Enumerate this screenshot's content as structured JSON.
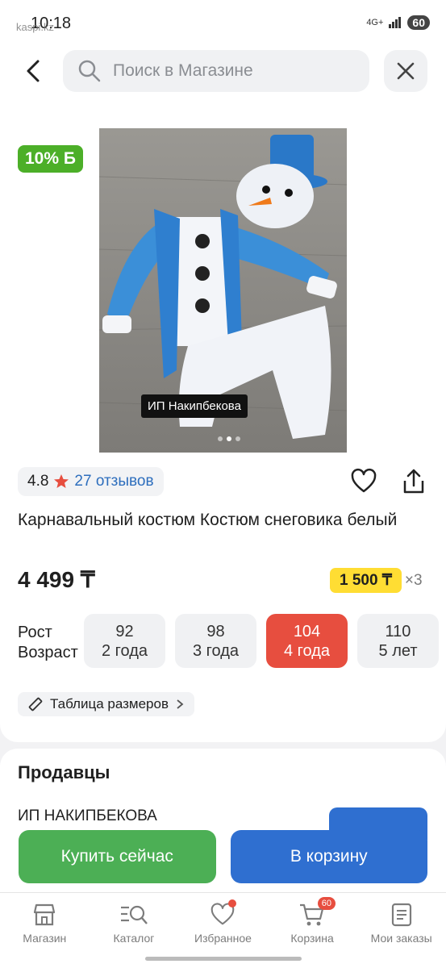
{
  "status": {
    "time": "10:18",
    "app": "kaspi.kz",
    "network": "4G+",
    "battery": "60"
  },
  "search": {
    "placeholder": "Поиск в Магазине"
  },
  "product": {
    "badge": "10% Б",
    "seller_tag": "ИП Накипбекова",
    "rating": "4.8",
    "reviews": "27 отзывов",
    "title": "Карнавальный костюм Костюм снеговика белый",
    "price": "4 499 ₸",
    "installment_amount": "1 500 ₸",
    "installment_times": "×3",
    "size_labels": {
      "height": "Рост",
      "age": "Возраст"
    },
    "sizes": [
      {
        "height": "92",
        "age": "2 года",
        "selected": false
      },
      {
        "height": "98",
        "age": "3 года",
        "selected": false
      },
      {
        "height": "104",
        "age": "4 года",
        "selected": true
      },
      {
        "height": "110",
        "age": "5 лет",
        "selected": false
      }
    ],
    "size_table": "Таблица размеров"
  },
  "sellers": {
    "heading": "Продавцы",
    "first_seller": "ИП НАКИПБЕКОВА"
  },
  "actions": {
    "buy_now": "Купить сейчас",
    "add_to_cart": "В корзину"
  },
  "nav": {
    "items": [
      {
        "label": "Магазин",
        "icon": "store-icon"
      },
      {
        "label": "Каталог",
        "icon": "catalog-search-icon"
      },
      {
        "label": "Избранное",
        "icon": "heart-icon"
      },
      {
        "label": "Корзина",
        "icon": "cart-icon",
        "count": "60"
      },
      {
        "label": "Мои заказы",
        "icon": "orders-icon"
      }
    ]
  },
  "colors": {
    "accent_blue": "#2f6fd0",
    "buy_green": "#4caf55",
    "selected_red": "#e74e3f",
    "installment_yellow": "#ffdd33",
    "badge_green": "#4caf28"
  }
}
